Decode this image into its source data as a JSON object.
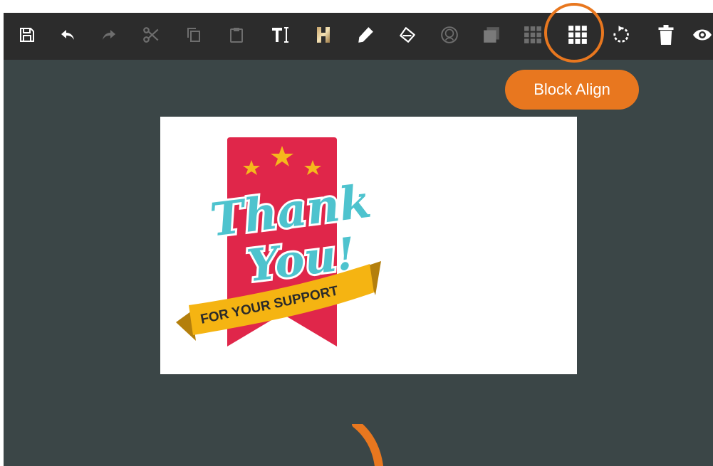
{
  "toolbar": {
    "tools": [
      {
        "name": "save-button",
        "icon": "save-icon",
        "label": "Save",
        "enabled": true
      },
      {
        "name": "undo-button",
        "icon": "undo-icon",
        "label": "Undo",
        "enabled": true
      },
      {
        "name": "redo-button",
        "icon": "redo-icon",
        "label": "Redo",
        "enabled": false
      },
      {
        "name": "cut-button",
        "icon": "scissors-icon",
        "label": "Cut",
        "enabled": false
      },
      {
        "name": "copy-button",
        "icon": "copy-icon",
        "label": "Copy",
        "enabled": false
      },
      {
        "name": "paste-button",
        "icon": "clipboard-icon",
        "label": "Paste",
        "enabled": false
      },
      {
        "name": "add-text-button",
        "icon": "text-cursor-icon",
        "label": "Text",
        "enabled": true
      },
      {
        "name": "texture-button",
        "icon": "texture-h-icon",
        "label": "Texture",
        "enabled": true
      },
      {
        "name": "pen-button",
        "icon": "pen-icon",
        "label": "Pen",
        "enabled": true
      },
      {
        "name": "fill-button",
        "icon": "paint-bucket-icon",
        "label": "Fill",
        "enabled": true
      },
      {
        "name": "face-button",
        "icon": "face-icon",
        "label": "Face",
        "enabled": false
      },
      {
        "name": "layer-button",
        "icon": "layers-icon",
        "label": "Layer",
        "enabled": false
      },
      {
        "name": "grid-button",
        "icon": "grid-icon",
        "label": "Grid",
        "enabled": false
      },
      {
        "name": "block-align-button",
        "icon": "grid-icon",
        "label": "Block Align",
        "enabled": true
      },
      {
        "name": "rotate-button",
        "icon": "rotate-icon",
        "label": "Rotate",
        "enabled": true
      },
      {
        "name": "delete-button",
        "icon": "trash-icon",
        "label": "Delete",
        "enabled": true
      },
      {
        "name": "preview-button",
        "icon": "eye-icon",
        "label": "Preview",
        "enabled": true
      }
    ],
    "highlighted": "block-align-button"
  },
  "tooltip": {
    "text": "Block Align"
  },
  "canvas": {
    "artwork": {
      "title_line1": "Thank",
      "title_line2": "You!",
      "ribbon_text": "FOR YOUR SUPPORT"
    }
  },
  "colors": {
    "toolbar_bg": "#2c2c2c",
    "workspace_bg": "#3b4647",
    "accent": "#e8771f",
    "icon": "#ffffff",
    "icon_disabled": "#6e6e6e",
    "banner_red": "#e0264a",
    "star_gold": "#f5b81c",
    "script_teal": "#4ec3ce",
    "ribbon_gold": "#f5b412"
  }
}
